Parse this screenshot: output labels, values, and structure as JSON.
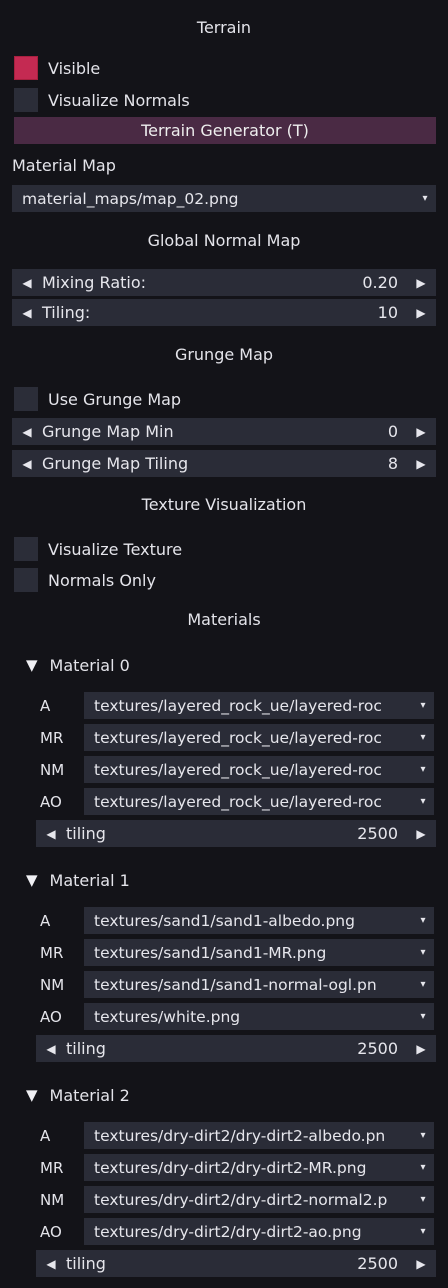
{
  "panel": {
    "title": "Terrain",
    "visible_label": "Visible",
    "visualize_normals_label": "Visualize Normals",
    "generator_button": "Terrain Generator (T)"
  },
  "material_map": {
    "label": "Material Map",
    "value": "material_maps/map_02.png",
    "arrow_icon": "dropdown-arrow-icon"
  },
  "global_normal_map": {
    "title": "Global Normal Map",
    "mixing_ratio": {
      "label": "Mixing Ratio:",
      "value": "0.20"
    },
    "tiling": {
      "label": "Tiling:",
      "value": "10"
    }
  },
  "grunge_map": {
    "title": "Grunge Map",
    "use_label": "Use Grunge Map",
    "min": {
      "label": "Grunge Map Min",
      "value": "0"
    },
    "tiling": {
      "label": "Grunge Map Tiling",
      "value": "8"
    }
  },
  "texture_visualization": {
    "title": "Texture Visualization",
    "visualize_label": "Visualize Texture",
    "normals_only_label": "Normals Only"
  },
  "materials": {
    "title": "Materials",
    "items": [
      {
        "name": "Material 0",
        "slots": [
          {
            "label": "A",
            "value": "textures/layered_rock_ue/layered-roc"
          },
          {
            "label": "MR",
            "value": "textures/layered_rock_ue/layered-roc"
          },
          {
            "label": "NM",
            "value": "textures/layered_rock_ue/layered-roc"
          },
          {
            "label": "AO",
            "value": "textures/layered_rock_ue/layered-roc"
          }
        ],
        "tiling": {
          "label": "tiling",
          "value": "2500"
        }
      },
      {
        "name": "Material 1",
        "slots": [
          {
            "label": "A",
            "value": "textures/sand1/sand1-albedo.png"
          },
          {
            "label": "MR",
            "value": "textures/sand1/sand1-MR.png"
          },
          {
            "label": "NM",
            "value": "textures/sand1/sand1-normal-ogl.pn"
          },
          {
            "label": "AO",
            "value": "textures/white.png"
          }
        ],
        "tiling": {
          "label": "tiling",
          "value": "2500"
        }
      },
      {
        "name": "Material 2",
        "slots": [
          {
            "label": "A",
            "value": "textures/dry-dirt2/dry-dirt2-albedo.pn"
          },
          {
            "label": "MR",
            "value": "textures/dry-dirt2/dry-dirt2-MR.png"
          },
          {
            "label": "NM",
            "value": "textures/dry-dirt2/dry-dirt2-normal2.p"
          },
          {
            "label": "AO",
            "value": "textures/dry-dirt2/dry-dirt2-ao.png"
          }
        ],
        "tiling": {
          "label": "tiling",
          "value": "2500"
        }
      }
    ]
  },
  "colors": {
    "background": "#131318",
    "field": "#2a2c37",
    "checkbox_checked": "#c42a52",
    "button": "#4a2a44",
    "text": "#e4e4ea"
  }
}
